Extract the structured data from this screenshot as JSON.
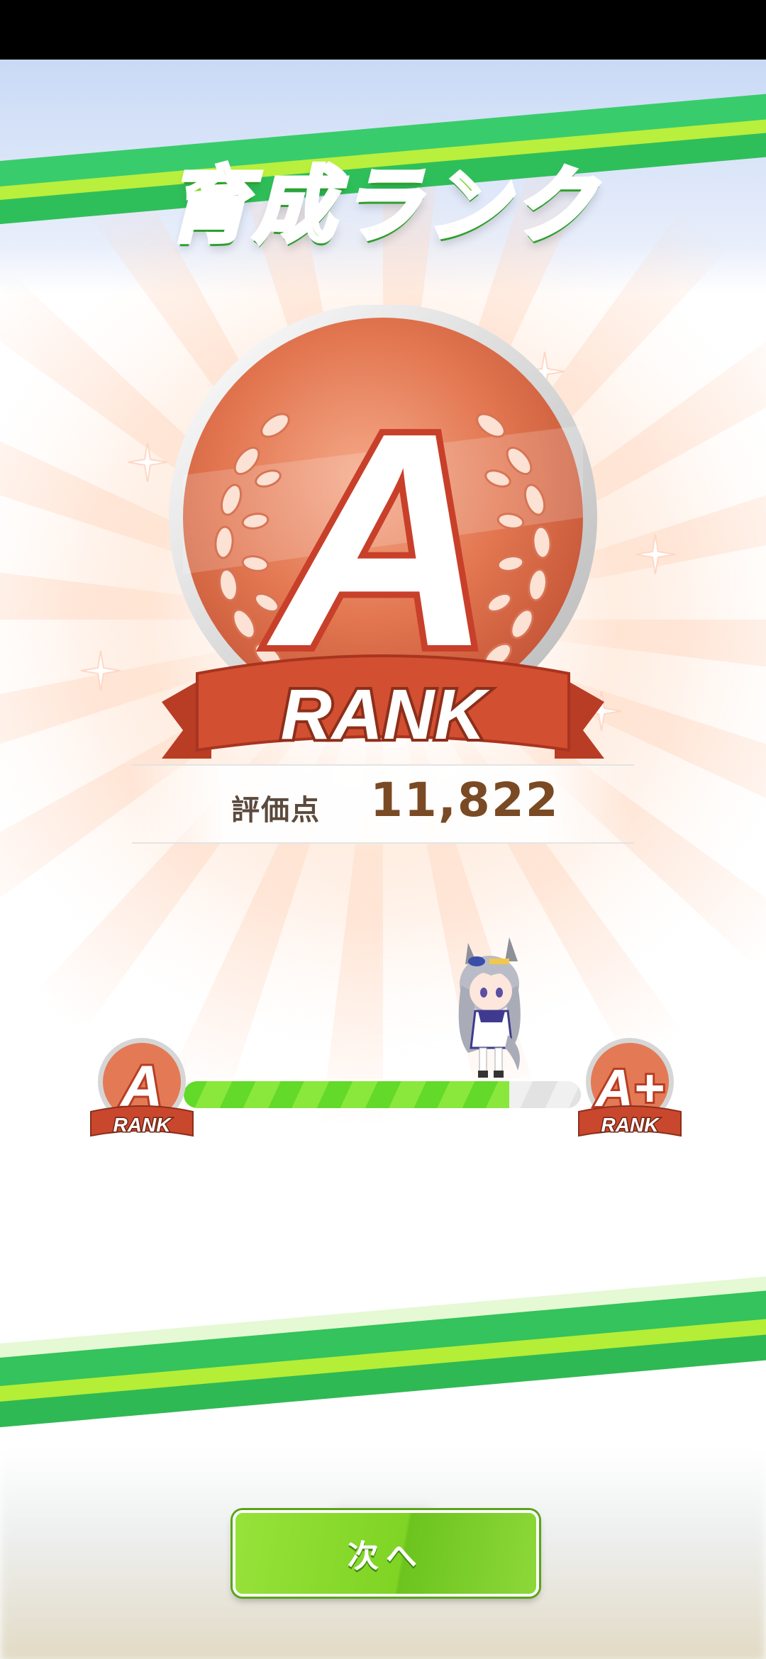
{
  "screen": {
    "title": "育成ランク",
    "rank": {
      "letter": "A",
      "ribbon_label": "RANK"
    },
    "score": {
      "label": "評価点",
      "value": "11,822"
    },
    "progress": {
      "current_rank": "A",
      "next_rank": "A+",
      "badge_label": "RANK",
      "fill_fraction": 0.82
    },
    "next_button_label": "次へ"
  },
  "colors": {
    "title_green": "#7ad92c",
    "medal_copper": "#e67a56",
    "ribbon_red": "#c8472d",
    "button_green": "#7fd424"
  }
}
